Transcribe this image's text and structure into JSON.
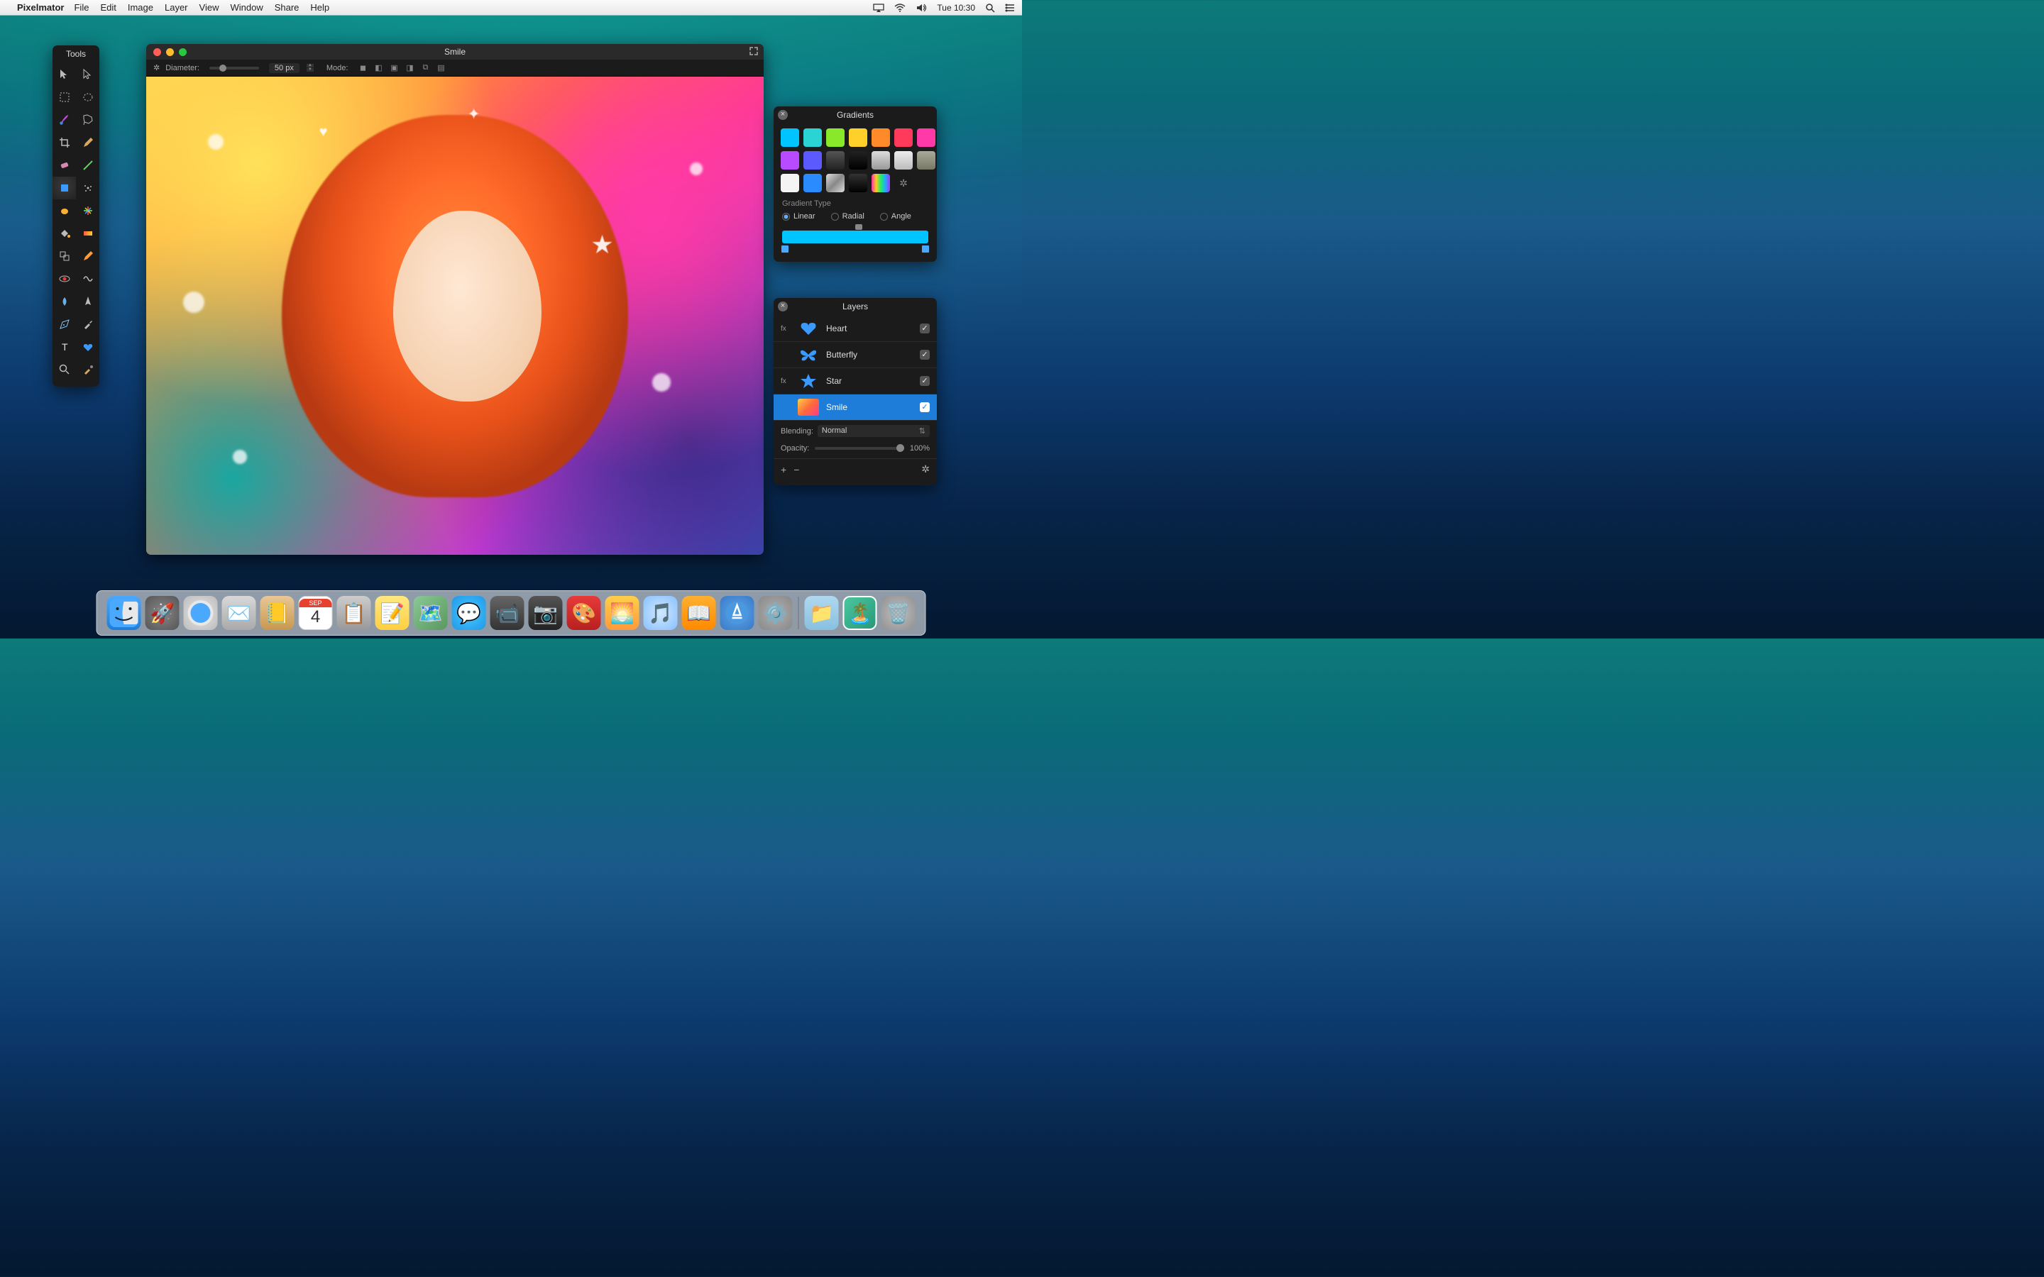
{
  "menubar": {
    "app": "Pixelmator",
    "items": [
      "File",
      "Edit",
      "Image",
      "Layer",
      "View",
      "Window",
      "Share",
      "Help"
    ],
    "clock": "Tue 10:30"
  },
  "tools": {
    "title": "Tools",
    "items": [
      "move-tool",
      "selection-arrow-tool",
      "marquee-tool",
      "ellipse-select-tool",
      "brush-tool",
      "lasso-tool",
      "crop-tool",
      "pencil-tool",
      "eraser-tool",
      "line-tool",
      "shape-tool",
      "spray-tool",
      "smudge-tool",
      "color-burst-tool",
      "paint-bucket-tool",
      "gradient-tool",
      "clone-tool",
      "color-pencil-tool",
      "red-eye-tool",
      "warp-tool",
      "blur-tool",
      "sharpen-tool",
      "pen-tool",
      "eyedropper-tool",
      "text-tool",
      "heart-shape-tool",
      "zoom-tool",
      "color-picker-tool"
    ]
  },
  "canvas": {
    "title": "Smile",
    "diameter_label": "Diameter:",
    "diameter_value": "50 px",
    "mode_label": "Mode:"
  },
  "gradients": {
    "title": "Gradients",
    "type_label": "Gradient Type",
    "options": [
      "Linear",
      "Radial",
      "Angle"
    ],
    "selected": "Linear",
    "swatches_row1": [
      "#00c4ff",
      "#2ad4d4",
      "#8ae82a",
      "#ffcf2a",
      "#ff8a2a",
      "#ff3a5a",
      "#ff3aa8"
    ],
    "swatches_row2": [
      "#b84aff",
      "#5a5aff",
      "#3a3a3a",
      "#1a1a1a",
      "#b0b0b0",
      "#d8d8d8",
      "#8a8a6a"
    ],
    "swatches_row3": [
      "#f4f4f4",
      "#2a8aff",
      "metal",
      "black",
      "rainbow"
    ]
  },
  "layers": {
    "title": "Layers",
    "items": [
      {
        "name": "Heart",
        "fx": true,
        "icon": "heart",
        "checked": true
      },
      {
        "name": "Butterfly",
        "fx": false,
        "icon": "butterfly",
        "checked": true
      },
      {
        "name": "Star",
        "fx": true,
        "icon": "star",
        "checked": true
      },
      {
        "name": "Smile",
        "fx": false,
        "icon": "image",
        "checked": true,
        "selected": true
      }
    ],
    "blending_label": "Blending:",
    "blending_value": "Normal",
    "opacity_label": "Opacity:",
    "opacity_value": "100%"
  },
  "dock": {
    "cal_month": "SEP",
    "cal_day": "4",
    "items": [
      "finder",
      "launchpad",
      "safari",
      "mail",
      "contacts",
      "calendar",
      "reminders",
      "notes",
      "maps",
      "messages",
      "facetime",
      "photobooth",
      "pixelmator",
      "iphoto",
      "itunes",
      "ibooks",
      "appstore",
      "sysprefs",
      "documents-folder",
      "photo-stack",
      "trash"
    ]
  }
}
